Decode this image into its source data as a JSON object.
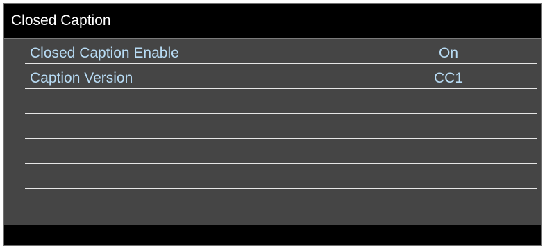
{
  "window": {
    "title": "Closed Caption"
  },
  "menu": {
    "items": [
      {
        "label": "Closed Caption Enable",
        "value": "On"
      },
      {
        "label": "Caption Version",
        "value": "CC1"
      },
      {
        "label": "",
        "value": ""
      },
      {
        "label": "",
        "value": ""
      },
      {
        "label": "",
        "value": ""
      },
      {
        "label": "",
        "value": ""
      }
    ]
  },
  "colors": {
    "header_bg": "#000000",
    "body_bg": "#454545",
    "item_text": "#b8dcf5",
    "title_text": "#ffffff",
    "divider": "#e6e6e6"
  }
}
